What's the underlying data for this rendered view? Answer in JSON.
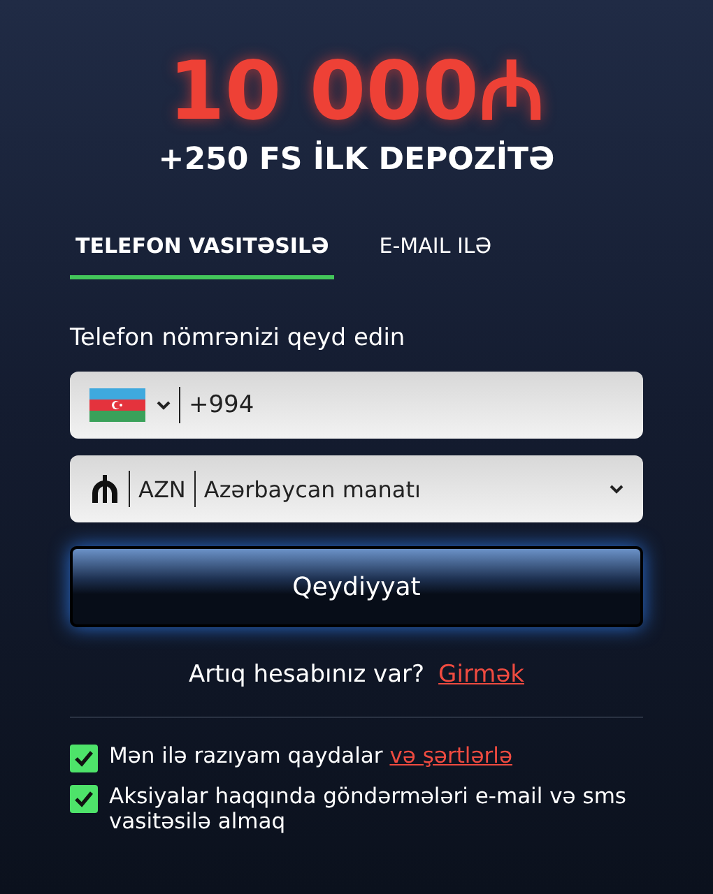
{
  "bonus": {
    "amount": "10 000₼",
    "subtitle": "+250 FS İLK DEPOZİTƏ"
  },
  "tabs": [
    {
      "label": "TELEFON VASITƏSILƏ",
      "selected": true
    },
    {
      "label": "E-MAIL ILƏ",
      "selected": false
    }
  ],
  "phone": {
    "label": "Telefon nömrənizi qeyd edin",
    "value": "+994"
  },
  "currency": {
    "code": "AZN",
    "name": "Azərbaycan manatı"
  },
  "submit": "Qeydiyyat",
  "login": {
    "text": "Artıq hesabınız var?",
    "link": "Girmək"
  },
  "checks": [
    {
      "text": "Mən ilə razıyam qaydalar",
      "link": "və şərtlərlə",
      "checked": true
    },
    {
      "text": "Aksiyalar haqqında göndərmələri e-mail və sms vasitəsilə almaq",
      "checked": true
    }
  ]
}
